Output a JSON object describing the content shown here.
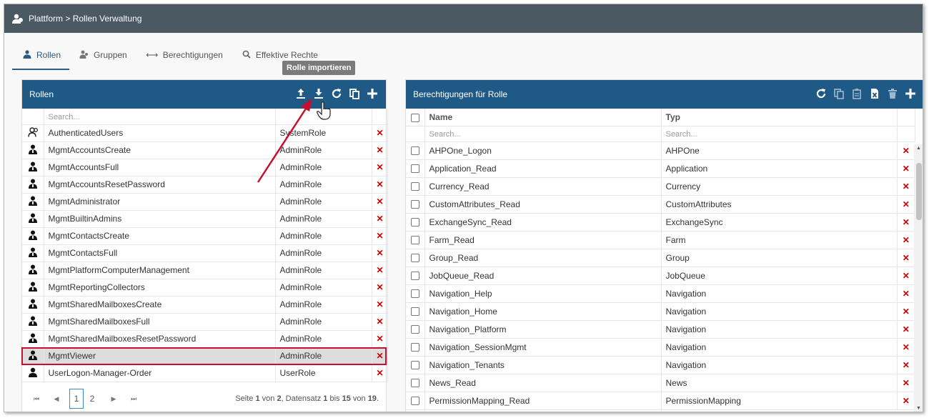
{
  "topbar": {
    "breadcrumb": "Plattform > Rollen Verwaltung"
  },
  "tabs": [
    {
      "label": "Rollen",
      "icon": "role-icon",
      "active": true
    },
    {
      "label": "Gruppen",
      "icon": "group-icon",
      "active": false
    },
    {
      "label": "Berechtigungen",
      "icon": "arrows-icon",
      "active": false
    },
    {
      "label": "Effektive Rechte",
      "icon": "search-icon",
      "active": false
    }
  ],
  "tooltip": "Rolle importieren",
  "left_panel": {
    "title": "Rollen",
    "search_placeholder": "Search...",
    "rows": [
      {
        "icon": "group-role-icon",
        "name": "AuthenticatedUsers",
        "type": "SystemRole"
      },
      {
        "icon": "admin-role-icon",
        "name": "MgmtAccountsCreate",
        "type": "AdminRole"
      },
      {
        "icon": "admin-role-icon",
        "name": "MgmtAccountsFull",
        "type": "AdminRole"
      },
      {
        "icon": "admin-role-icon",
        "name": "MgmtAccountsResetPassword",
        "type": "AdminRole"
      },
      {
        "icon": "admin-role-icon",
        "name": "MgmtAdministrator",
        "type": "AdminRole"
      },
      {
        "icon": "admin-role-icon",
        "name": "MgmtBuiltinAdmins",
        "type": "AdminRole"
      },
      {
        "icon": "admin-role-icon",
        "name": "MgmtContactsCreate",
        "type": "AdminRole"
      },
      {
        "icon": "admin-role-icon",
        "name": "MgmtContactsFull",
        "type": "AdminRole"
      },
      {
        "icon": "admin-role-icon",
        "name": "MgmtPlatformComputerManagement",
        "type": "AdminRole"
      },
      {
        "icon": "admin-role-icon",
        "name": "MgmtReportingCollectors",
        "type": "AdminRole"
      },
      {
        "icon": "admin-role-icon",
        "name": "MgmtSharedMailboxesCreate",
        "type": "AdminRole"
      },
      {
        "icon": "admin-role-icon",
        "name": "MgmtSharedMailboxesFull",
        "type": "AdminRole"
      },
      {
        "icon": "admin-role-icon",
        "name": "MgmtSharedMailboxesResetPassword",
        "type": "AdminRole"
      },
      {
        "icon": "admin-role-icon",
        "name": "MgmtViewer",
        "type": "AdminRole",
        "selected": true
      },
      {
        "icon": "user-role-icon",
        "name": "UserLogon-Manager-Order",
        "type": "UserRole"
      }
    ],
    "pager": {
      "first": "⏮",
      "prev": "◀",
      "next": "▶",
      "last": "⏭",
      "pages": [
        "1",
        "2"
      ],
      "current": "1",
      "info_prefix": "Seite ",
      "page": "1",
      "info_of": " von ",
      "total_pages": "2",
      "info_record": ", Datensatz ",
      "from": "1",
      "info_to": " bis ",
      "to": "15",
      "info_of2": " von ",
      "total": "19",
      "info_end": "."
    }
  },
  "right_panel": {
    "title": "Berechtigungen für Rolle",
    "col_name": "Name",
    "col_type": "Typ",
    "search_placeholder": "Search...",
    "rows": [
      {
        "name": "AHPOne_Logon",
        "type": "AHPOne"
      },
      {
        "name": "Application_Read",
        "type": "Application"
      },
      {
        "name": "Currency_Read",
        "type": "Currency"
      },
      {
        "name": "CustomAttributes_Read",
        "type": "CustomAttributes"
      },
      {
        "name": "ExchangeSync_Read",
        "type": "ExchangeSync"
      },
      {
        "name": "Farm_Read",
        "type": "Farm"
      },
      {
        "name": "Group_Read",
        "type": "Group"
      },
      {
        "name": "JobQueue_Read",
        "type": "JobQueue"
      },
      {
        "name": "Navigation_Help",
        "type": "Navigation"
      },
      {
        "name": "Navigation_Home",
        "type": "Navigation"
      },
      {
        "name": "Navigation_Platform",
        "type": "Navigation"
      },
      {
        "name": "Navigation_SessionMgmt",
        "type": "Navigation"
      },
      {
        "name": "Navigation_Tenants",
        "type": "Navigation"
      },
      {
        "name": "News_Read",
        "type": "News"
      },
      {
        "name": "PermissionMapping_Read",
        "type": "PermissionMapping"
      }
    ]
  },
  "delete_glyph": "✕",
  "colors": {
    "topbar": "#4b5963",
    "panel_header": "#1f5a86",
    "accent": "#2b5b84",
    "delete": "#cc0000",
    "annotation": "#c8102e"
  }
}
